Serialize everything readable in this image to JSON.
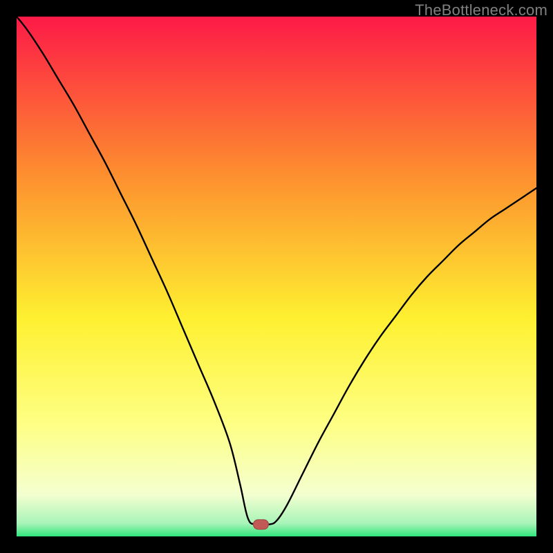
{
  "watermark": "TheBottleneck.com",
  "colors": {
    "frame": "#000000",
    "gradient_top": "#fd1a47",
    "gradient_mid_upper": "#fd8d2f",
    "gradient_mid": "#fef030",
    "gradient_mid_lower": "#feff82",
    "gradient_lower": "#f4ffd0",
    "gradient_bottom": "#2fe57c",
    "curve": "#000000",
    "marker_fill": "#c15a56",
    "marker_stroke": "#9c4340"
  },
  "chart_data": {
    "type": "line",
    "title": "",
    "xlabel": "",
    "ylabel": "",
    "xlim": [
      0,
      100
    ],
    "ylim": [
      0,
      100
    ],
    "x": [
      0,
      2,
      5,
      8,
      11,
      14,
      17,
      20,
      23,
      26,
      29,
      32,
      35,
      38,
      41,
      43,
      44.5,
      46,
      48.5,
      50,
      52,
      55,
      58,
      61,
      64,
      67,
      70,
      73,
      76,
      79,
      82,
      85,
      88,
      91,
      94,
      97,
      100
    ],
    "y": [
      100,
      97.5,
      93,
      88,
      83,
      77.5,
      72,
      66,
      60,
      53.5,
      47,
      40,
      33,
      26,
      18,
      10,
      3.5,
      2.3,
      2.3,
      3,
      6,
      12,
      18,
      23.5,
      29,
      34,
      38.5,
      42.5,
      46.5,
      50,
      53,
      56,
      58.5,
      61,
      63,
      65,
      67
    ],
    "marker": {
      "x": 47,
      "y": 2.3
    },
    "grid": false,
    "legend": false
  }
}
